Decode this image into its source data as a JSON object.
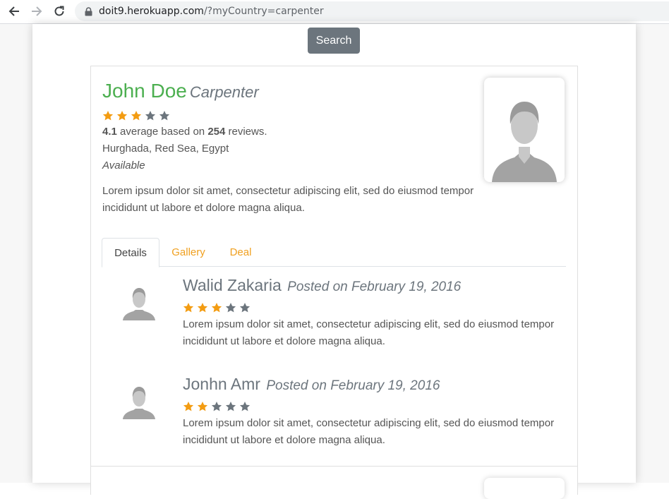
{
  "browser": {
    "url_host": "doit9.herokuapp.com",
    "url_path": "/?myCountry=carpenter"
  },
  "search": {
    "label": "Search"
  },
  "profile": {
    "name": "John Doe",
    "profession": "Carpenter",
    "stars_filled": 3,
    "stars_total": 5,
    "average": "4.1",
    "average_text": "average based on",
    "review_count": "254",
    "reviews_word": "reviews.",
    "location": "Hurghada, Red Sea, Egypt",
    "availability": "Available",
    "bio": "Lorem ipsum dolor sit amet, consectetur adipiscing elit, sed do eiusmod tempor incididunt ut labore et dolore magna aliqua."
  },
  "tabs": [
    {
      "label": "Details"
    },
    {
      "label": "Gallery"
    },
    {
      "label": "Deal"
    }
  ],
  "reviews": [
    {
      "name": "Walid Zakaria",
      "posted": "Posted on February 19, 2016",
      "stars_filled": 3,
      "text": "Lorem ipsum dolor sit amet, consectetur adipiscing elit, sed do eiusmod tempor incididunt ut labore et dolore magna aliqua."
    },
    {
      "name": "Jonhn Amr",
      "posted": "Posted on February 19, 2016",
      "stars_filled": 2,
      "text": "Lorem ipsum dolor sit amet, consectetur adipiscing elit, sed do eiusmod tempor incididunt ut labore et dolore magna aliqua."
    }
  ],
  "colors": {
    "star_filled": "#f39c12",
    "star_empty": "#6c757d",
    "name": "#4caf50",
    "tab_link": "#f0a020"
  }
}
